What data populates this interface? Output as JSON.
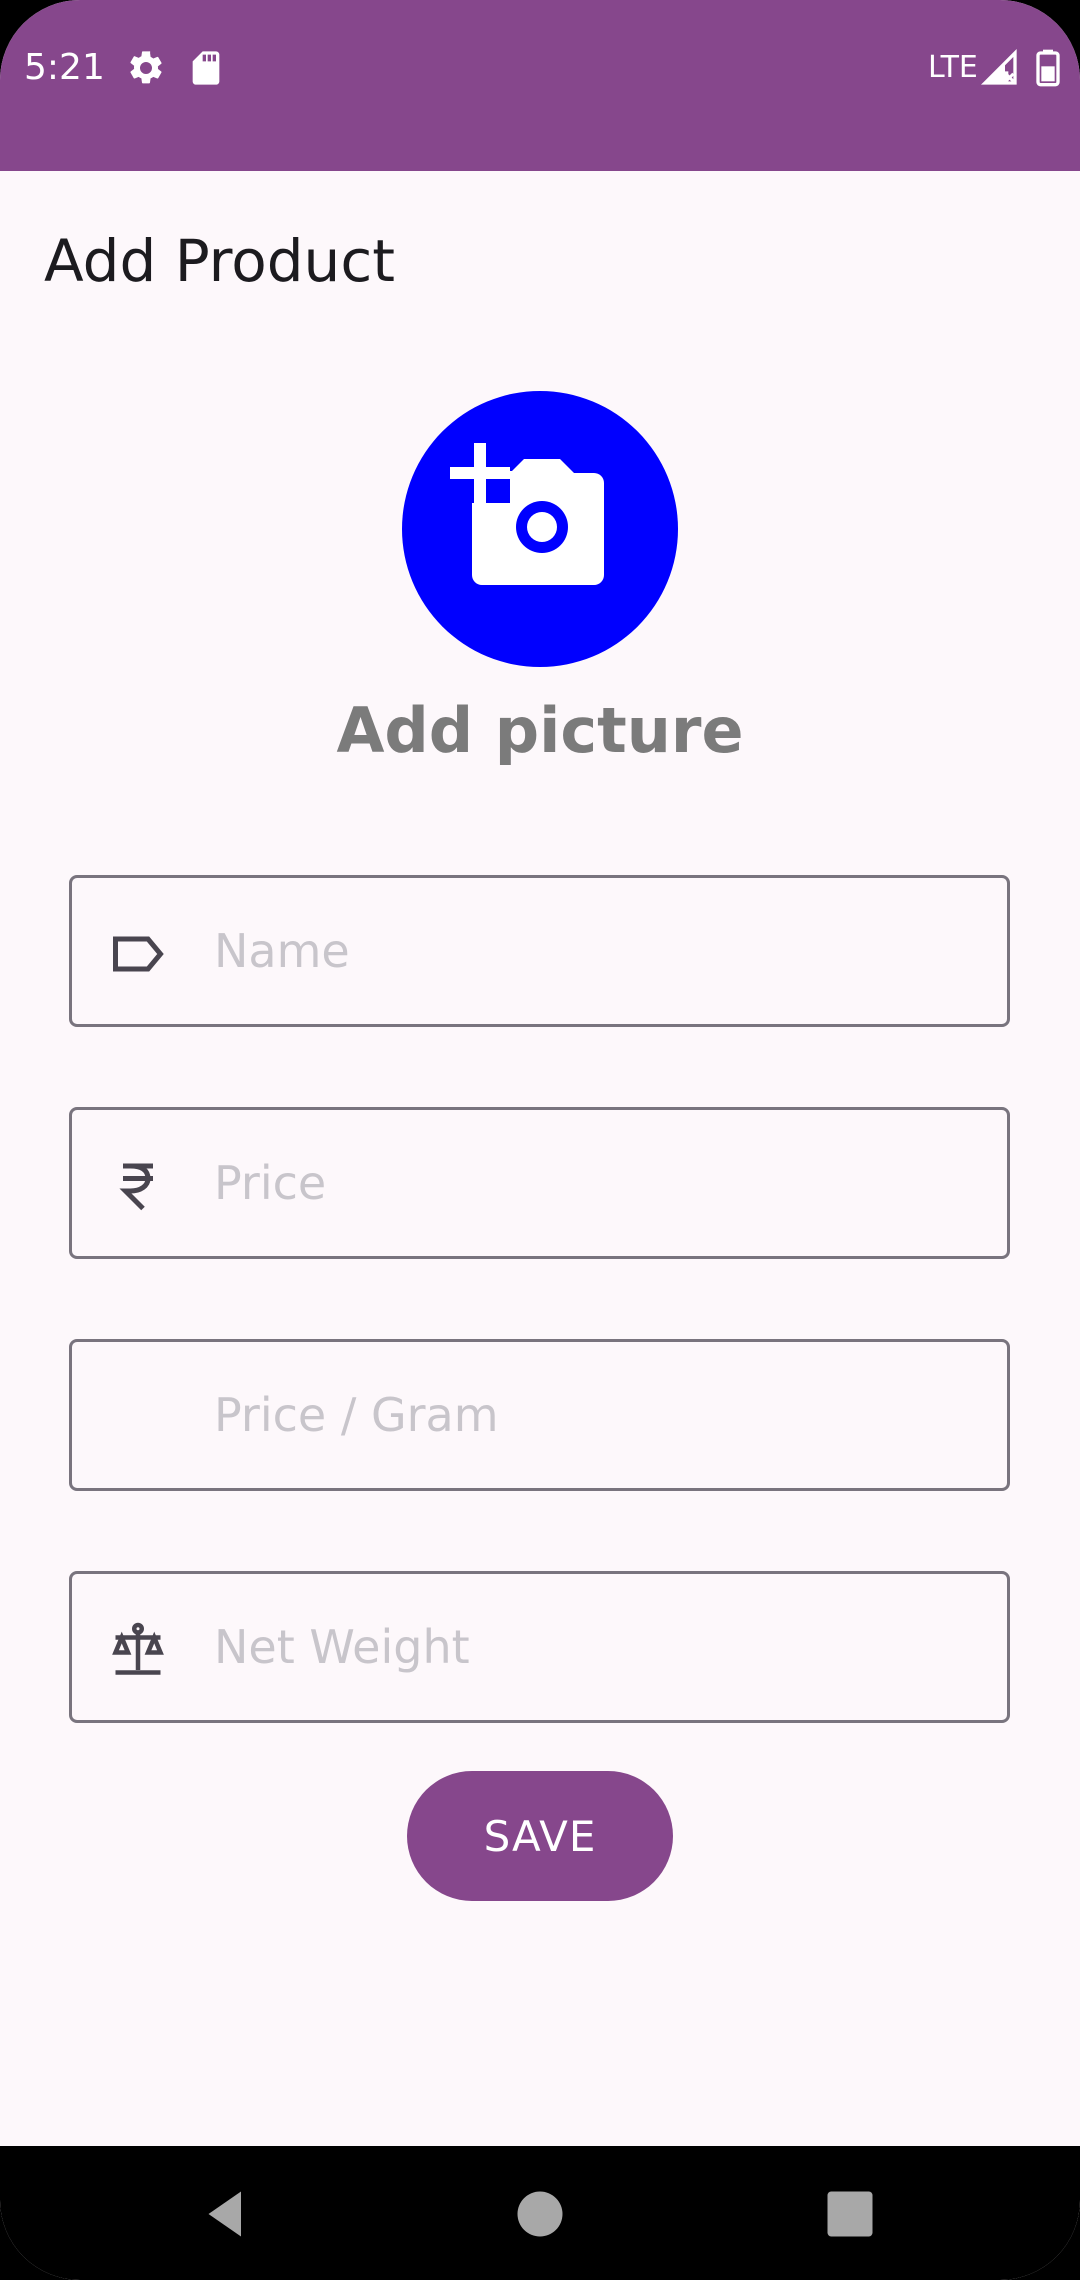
{
  "status_bar": {
    "time": "5:21",
    "network_label": "LTE",
    "background_color": "#86478c",
    "icons": [
      "settings-icon",
      "sd-card-icon",
      "signal-icon",
      "battery-icon"
    ]
  },
  "page": {
    "title": "Add Product"
  },
  "add_picture": {
    "icon": "add-a-photo-icon",
    "label": "Add picture",
    "color": "#0000ff"
  },
  "form": {
    "name": {
      "placeholder": "Name",
      "value": "",
      "icon": "label-tag-icon"
    },
    "price": {
      "placeholder": "Price",
      "value": "",
      "icon": "rupee-icon"
    },
    "price_per_gram": {
      "placeholder": "Price / Gram",
      "value": ""
    },
    "net_weight": {
      "placeholder": "Net Weight",
      "value": "",
      "icon": "scale-icon"
    }
  },
  "save_button": {
    "label": "SAVE",
    "color": "#86478c"
  },
  "nav_bar": {
    "buttons": [
      "back-icon",
      "home-icon",
      "recents-icon"
    ]
  }
}
